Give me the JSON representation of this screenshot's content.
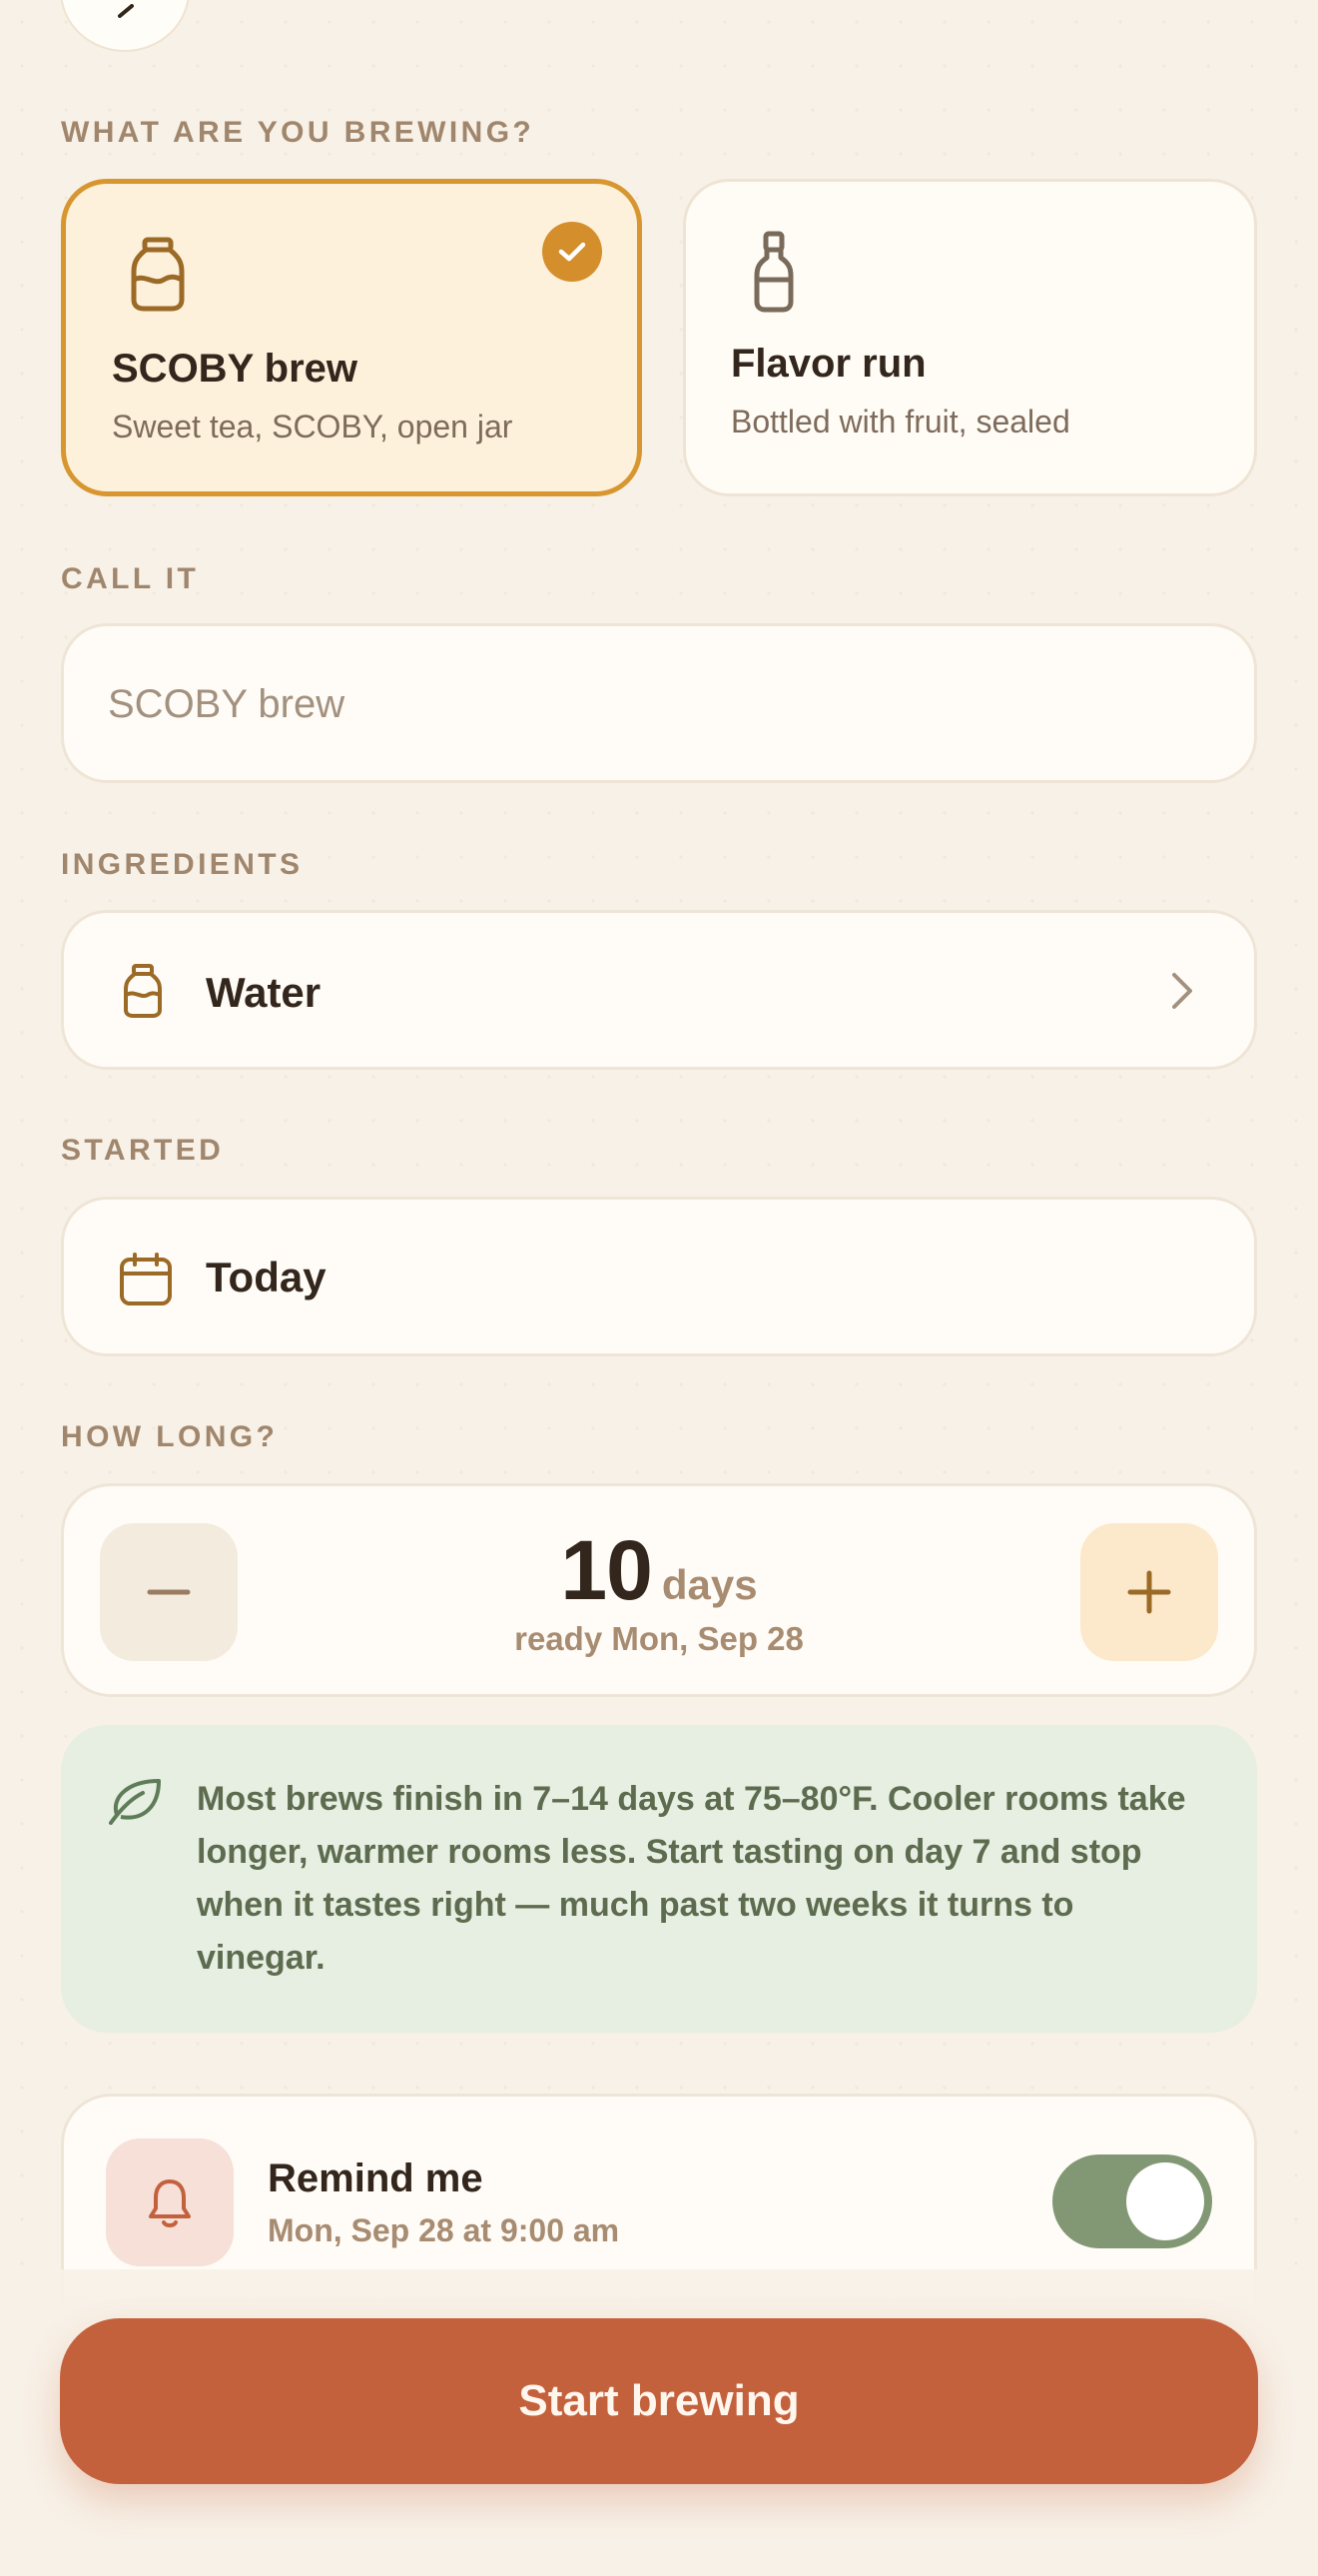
{
  "sections": {
    "type_label": "WHAT ARE YOU BREWING?",
    "name_label": "CALL IT",
    "ingredients_label": "INGREDIENTS",
    "started_label": "STARTED",
    "duration_label": "HOW LONG?"
  },
  "brew_types": [
    {
      "title": "SCOBY brew",
      "subtitle": "Sweet tea, SCOBY, open jar",
      "selected": true,
      "icon": "jar-icon"
    },
    {
      "title": "Flavor run",
      "subtitle": "Bottled with fruit, sealed",
      "selected": false,
      "icon": "bottle-icon"
    }
  ],
  "name_field": {
    "placeholder": "SCOBY brew"
  },
  "ingredients": {
    "value": "Water",
    "icon": "jar-icon"
  },
  "started": {
    "value": "Today",
    "icon": "calendar-icon"
  },
  "duration": {
    "value": "10",
    "unit": "days",
    "ready": "ready Mon, Sep 28"
  },
  "tip": {
    "icon": "leaf-icon",
    "text": "Most brews finish in 7–14 days at 75–80°F. Cooler rooms take longer, warmer rooms less. Start tasting on day 7 and stop when it tastes right — much past two weeks it turns to vinegar."
  },
  "reminder": {
    "title": "Remind me",
    "subtitle": "Mon, Sep 28 at 9:00 am",
    "enabled": true,
    "icon": "bell-icon"
  },
  "cta": {
    "label": "Start brewing"
  },
  "colors": {
    "background": "#f8f1e7",
    "accent": "#d48e2c",
    "cta": "#c4613d",
    "toggle_on": "#829874",
    "tip_bg": "#e7eee2"
  }
}
